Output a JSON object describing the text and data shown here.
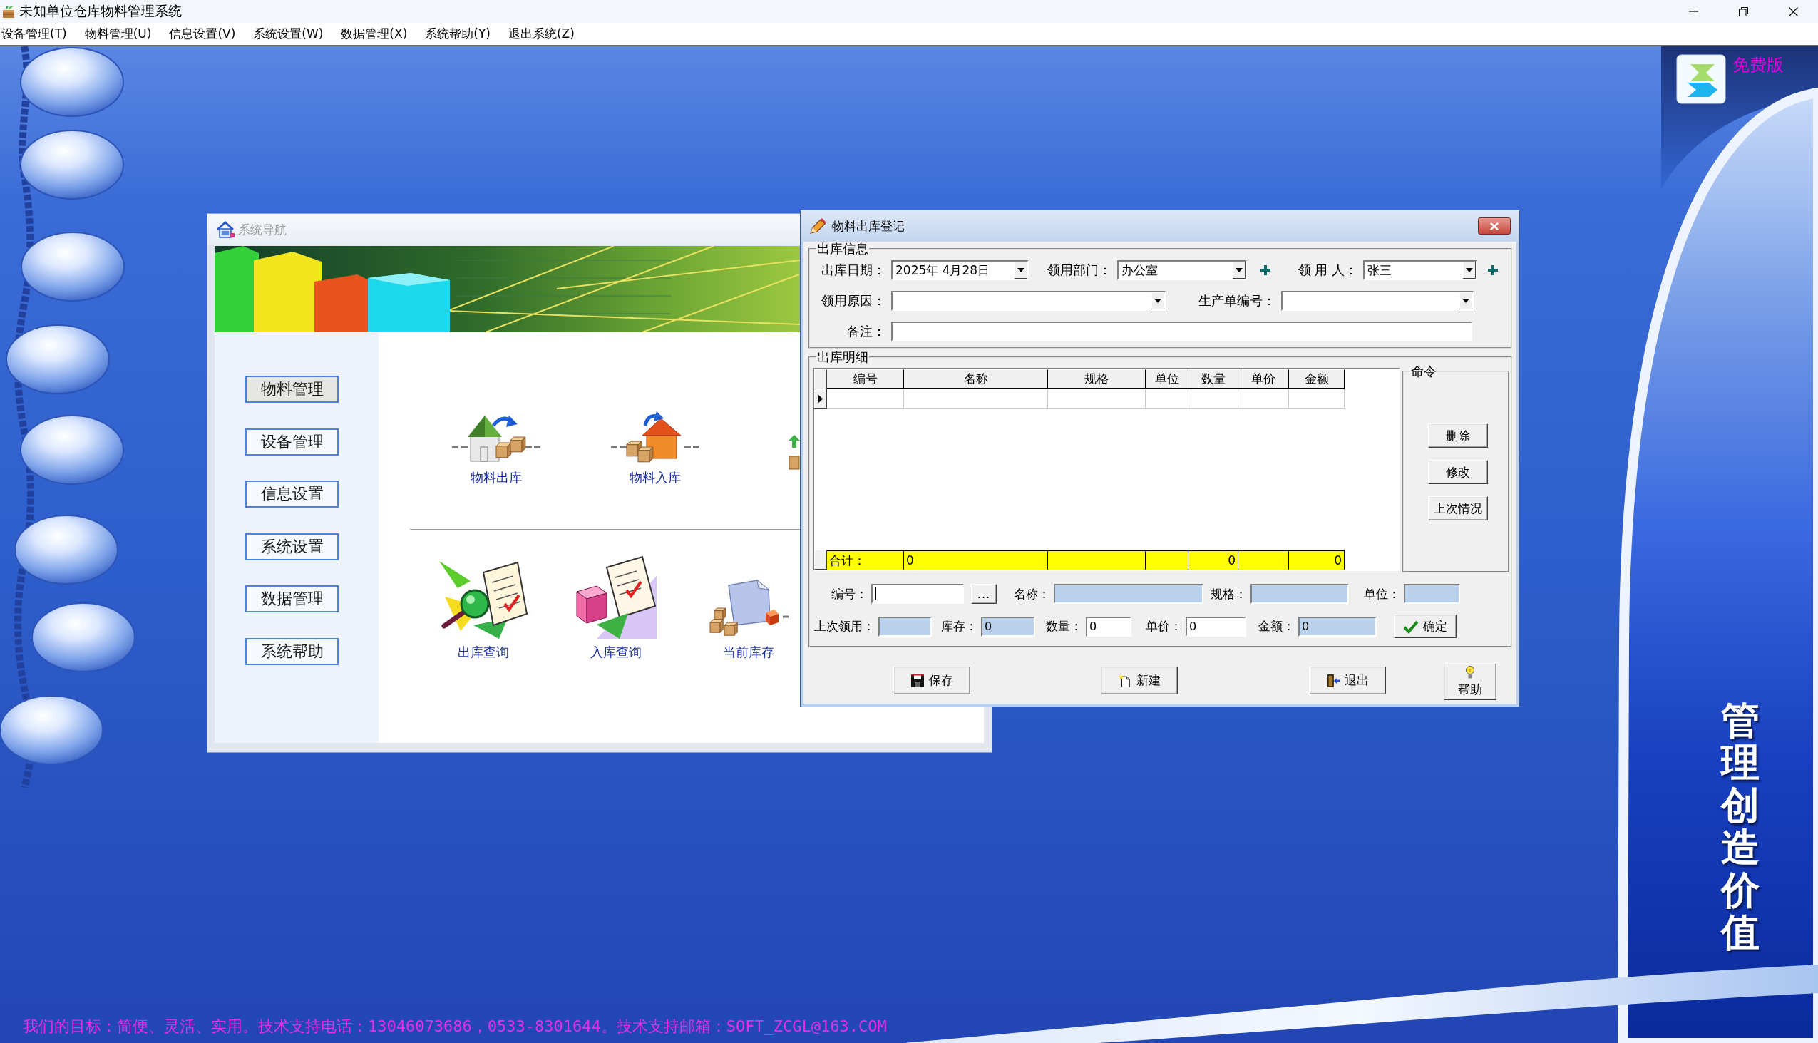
{
  "window": {
    "title": "未知单位仓库物料管理系统"
  },
  "menu": [
    "设备管理(T)",
    "物料管理(U)",
    "信息设置(V)",
    "系统设置(W)",
    "数据管理(X)",
    "系统帮助(Y)",
    "退出系统(Z)"
  ],
  "desktop": {
    "badge": "免费版",
    "slogan": "管理创造价值",
    "footer": "我们的目标：简便、灵活、实用。技术支持电话：13046073686，0533-8301644。技术支持邮箱：SOFT_ZCGL@163.COM"
  },
  "nav_window": {
    "title": "系统导航",
    "active": false,
    "sidebar": [
      {
        "label": "物料管理",
        "selected": true
      },
      {
        "label": "设备管理",
        "selected": false
      },
      {
        "label": "信息设置",
        "selected": false
      },
      {
        "label": "系统设置",
        "selected": false
      },
      {
        "label": "数据管理",
        "selected": false
      },
      {
        "label": "系统帮助",
        "selected": false
      }
    ],
    "shortcut_rows": [
      [
        {
          "label": "物料出库",
          "kind": "stock-out"
        },
        {
          "label": "物料入库",
          "kind": "stock-in"
        }
      ],
      [
        {
          "label": "出库查询",
          "kind": "out-query"
        },
        {
          "label": "入库查询",
          "kind": "in-query"
        },
        {
          "label": "当前库存",
          "kind": "inventory"
        }
      ]
    ]
  },
  "dialog": {
    "title": "物料出库登记",
    "active": true,
    "info_group": {
      "title": "出库信息",
      "rows": [
        [
          {
            "label": "出库日期：",
            "value": "2025年 4月28日",
            "kind": "combo"
          },
          {
            "label": "领用部门：",
            "value": "办公室",
            "kind": "combo-add"
          },
          {
            "label": "领 用 人：",
            "value": "张三",
            "kind": "combo-add"
          }
        ],
        [
          {
            "label": "领用原因：",
            "kind": "combo"
          },
          {
            "label": "生产单编号：",
            "kind": "combo"
          }
        ],
        [
          {
            "label": "备注：",
            "kind": "text"
          }
        ]
      ]
    },
    "detail_group": {
      "title": "出库明细",
      "columns": [
        "编号",
        "名称",
        "规格",
        "单位",
        "数量",
        "单价",
        "金额"
      ],
      "rows": [
        {
          "current": true
        }
      ],
      "totals": {
        "label": "合计：",
        "name": "0",
        "quantity": "0",
        "amount": "0"
      }
    },
    "command_group": {
      "title": "命令",
      "buttons": [
        "删除",
        "修改",
        "上次情况"
      ]
    },
    "entry_rows": [
      [
        {
          "label": "编号：",
          "kind": "input",
          "button": "...",
          "focused": true
        },
        {
          "label": "名称：",
          "kind": "readonly",
          "focused": false
        },
        {
          "label": "规格：",
          "kind": "readonly",
          "focused": false
        },
        {
          "label": "单位：",
          "kind": "readonly",
          "focused": false
        }
      ],
      [
        {
          "label": "上次领用：",
          "kind": "readonly",
          "focused": false
        },
        {
          "label": "库存：",
          "value": "0",
          "kind": "readonly",
          "focused": false
        },
        {
          "label": "数量：",
          "value": "0",
          "kind": "input",
          "focused": false
        },
        {
          "label": "单价：",
          "value": "0",
          "kind": "input",
          "focused": false
        },
        {
          "label": "金额：",
          "value": "0",
          "kind": "readonly",
          "focused": false
        }
      ]
    ],
    "confirm_button": "确定",
    "footer_buttons": [
      {
        "label": "保存",
        "kind": "save"
      },
      {
        "label": "新建",
        "kind": "new"
      },
      {
        "label": "退出",
        "kind": "exit"
      },
      {
        "label": "帮助",
        "kind": "help"
      }
    ]
  }
}
